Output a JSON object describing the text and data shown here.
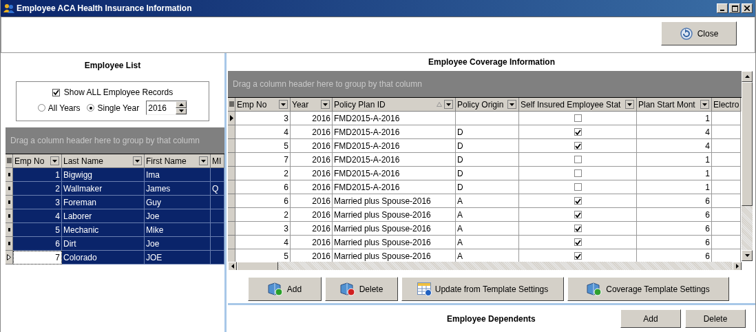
{
  "window": {
    "title": "Employee ACA Health Insurance Information"
  },
  "toolbar": {
    "close_button": "Close"
  },
  "employee_list": {
    "title": "Employee List",
    "show_all": {
      "label": "Show ALL Employee Records",
      "checked": true
    },
    "year_options": [
      {
        "label": "All Years",
        "selected": false
      },
      {
        "label": "Single Year",
        "selected": true
      }
    ],
    "year_value": "2016",
    "group_hint": "Drag a column header here to group by that column",
    "columns": [
      {
        "label": "Emp No",
        "filter": true
      },
      {
        "label": "Last Name",
        "filter": true
      },
      {
        "label": "First Name",
        "filter": true
      },
      {
        "label": "MI",
        "filter": false
      }
    ],
    "rows": [
      {
        "emp_no": "1",
        "last_name": "Bigwigg",
        "first_name": "Ima",
        "selected": true,
        "current": false
      },
      {
        "emp_no": "2",
        "last_name": "Wallmaker",
        "first_name": "James",
        "mi": "Q",
        "selected": true,
        "current": false
      },
      {
        "emp_no": "3",
        "last_name": "Foreman",
        "first_name": "Guy",
        "selected": true,
        "current": false
      },
      {
        "emp_no": "4",
        "last_name": "Laborer",
        "first_name": "Joe",
        "selected": true,
        "current": false
      },
      {
        "emp_no": "5",
        "last_name": "Mechanic",
        "first_name": "Mike",
        "selected": true,
        "current": false
      },
      {
        "emp_no": "6",
        "last_name": "Dirt",
        "first_name": "Joe",
        "selected": true,
        "current": false
      },
      {
        "emp_no": "7",
        "last_name": "Colorado",
        "first_name": "JOE",
        "selected": true,
        "current": true
      }
    ]
  },
  "coverage": {
    "title": "Employee Coverage Information",
    "group_hint": "Drag a column header here to group by that column",
    "columns": [
      {
        "label": "Emp No",
        "filter": true,
        "sorted": false
      },
      {
        "label": "Year",
        "filter": true,
        "sorted": false
      },
      {
        "label": "Policy Plan ID",
        "filter": true,
        "sorted": true
      },
      {
        "label": "Policy Origin",
        "filter": true,
        "sorted": false
      },
      {
        "label": "Self Insured Employee Stat",
        "filter": true,
        "sorted": false
      },
      {
        "label": "Plan Start Mont",
        "filter": true,
        "sorted": false
      },
      {
        "label": "Electro",
        "filter": false,
        "sorted": false
      }
    ],
    "rows": [
      {
        "emp_no": "3",
        "year": "2016",
        "plan_id": "FMD2015-A-2016",
        "self_insured": false,
        "start_month": "1",
        "current": true
      },
      {
        "emp_no": "4",
        "year": "2016",
        "plan_id": "FMD2015-A-2016",
        "origin": "D",
        "self_insured": true,
        "start_month": "4",
        "current": false
      },
      {
        "emp_no": "5",
        "year": "2016",
        "plan_id": "FMD2015-A-2016",
        "origin": "D",
        "self_insured": true,
        "start_month": "4",
        "current": false
      },
      {
        "emp_no": "7",
        "year": "2016",
        "plan_id": "FMD2015-A-2016",
        "origin": "D",
        "self_insured": false,
        "start_month": "1",
        "current": false
      },
      {
        "emp_no": "2",
        "year": "2016",
        "plan_id": "FMD2015-A-2016",
        "origin": "D",
        "self_insured": false,
        "start_month": "1",
        "current": false
      },
      {
        "emp_no": "6",
        "year": "2016",
        "plan_id": "FMD2015-A-2016",
        "origin": "D",
        "self_insured": false,
        "start_month": "1",
        "current": false
      },
      {
        "emp_no": "6",
        "year": "2016",
        "plan_id": "Married plus Spouse-2016",
        "origin": "A",
        "self_insured": true,
        "start_month": "6",
        "current": false
      },
      {
        "emp_no": "2",
        "year": "2016",
        "plan_id": "Married plus Spouse-2016",
        "origin": "A",
        "self_insured": true,
        "start_month": "6",
        "current": false
      },
      {
        "emp_no": "3",
        "year": "2016",
        "plan_id": "Married plus Spouse-2016",
        "origin": "A",
        "self_insured": true,
        "start_month": "6",
        "current": false
      },
      {
        "emp_no": "4",
        "year": "2016",
        "plan_id": "Married plus Spouse-2016",
        "origin": "A",
        "self_insured": true,
        "start_month": "6",
        "current": false
      },
      {
        "emp_no": "5",
        "year": "2016",
        "plan_id": "Married plus Spouse-2016",
        "origin": "A",
        "self_insured": true,
        "start_month": "6",
        "current": false
      }
    ],
    "buttons": [
      {
        "label": "Add",
        "kind": "add"
      },
      {
        "label": "Delete",
        "kind": "delete"
      },
      {
        "label": "Update from Template Settings",
        "kind": "template"
      },
      {
        "label": "Coverage Template Settings",
        "kind": "coverage"
      }
    ]
  },
  "dependents": {
    "title": "Employee Dependents",
    "buttons": [
      "Add",
      "Delete"
    ]
  }
}
